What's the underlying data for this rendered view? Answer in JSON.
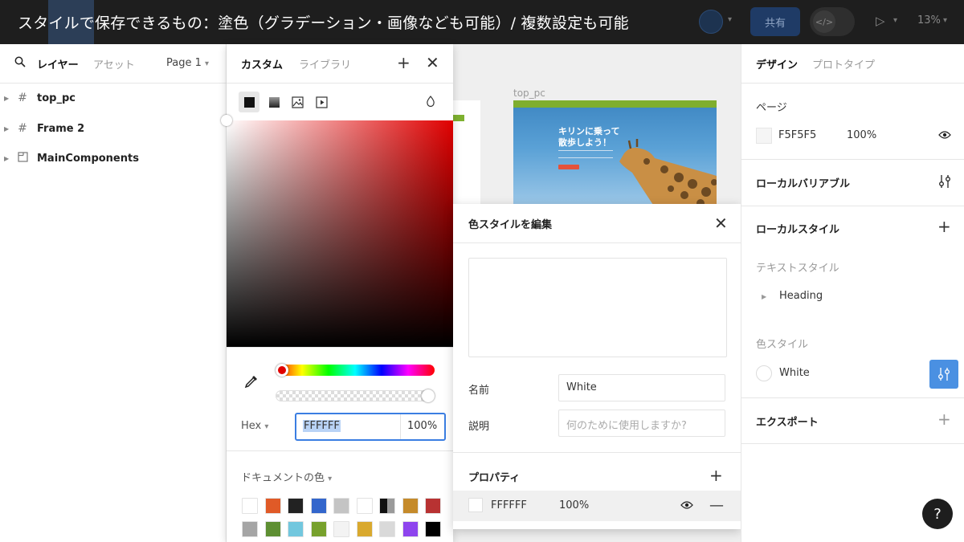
{
  "caption": "スタイルで保存できるもの：塗色（グラデーション・画像なども可能）/ 複数設定も可能",
  "toolbar": {
    "share_label": "共有",
    "zoom": "13%",
    "dev_mode_glyph": "</>"
  },
  "left_panel": {
    "tabs": [
      "レイヤー",
      "アセット"
    ],
    "page_label": "Page 1",
    "layers": [
      {
        "name": "top_pc",
        "icon": "frame-icon"
      },
      {
        "name": "Frame 2",
        "icon": "frame-icon"
      },
      {
        "name": "MainComponents",
        "icon": "section-icon"
      }
    ]
  },
  "canvas": {
    "frame_label": "top_pc",
    "hero_title": "キリンに乗って\n散歩しよう！"
  },
  "color_picker": {
    "tabs": [
      "カスタム",
      "ライブラリ"
    ],
    "paint_types": [
      "solid",
      "gradient",
      "image",
      "video"
    ],
    "current_color": "#FFFFFF",
    "hue_color": "#E00000",
    "format": "Hex",
    "hex": "FFFFFF",
    "opacity": "100%",
    "doc_colors_label": "ドキュメントの色",
    "doc_colors": [
      "#FFFFFF",
      "#E05A27",
      "#222222",
      "#3366CC",
      "#C4C4C4",
      "#FFFFFF",
      "#111111",
      "#C58A2A",
      "#B83232",
      "#A5A5A5",
      "#5E8F32",
      "#72C7DE",
      "#77A12C",
      "#F3F3F3",
      "#D9A92E",
      "#D9D9D9",
      "#8E44EE",
      "#000000"
    ]
  },
  "edit_style": {
    "title": "色スタイルを編集",
    "name_label": "名前",
    "name_value": "White",
    "desc_label": "説明",
    "desc_placeholder": "何のために使用しますか?",
    "properties_label": "プロパティ",
    "property": {
      "hex": "FFFFFF",
      "opacity": "100%"
    }
  },
  "right_panel": {
    "tabs": [
      "デザイン",
      "プロトタイプ"
    ],
    "page_section": "ページ",
    "page_color": {
      "hex": "F5F5F5",
      "opacity": "100%",
      "swatch": "#F5F5F5"
    },
    "local_variables": "ローカルバリアブル",
    "local_styles": "ローカルスタイル",
    "text_styles_label": "テキストスタイル",
    "text_style_item": "Heading",
    "color_styles_label": "色スタイル",
    "color_style_item": "White",
    "export_label": "エクスポート",
    "help": "?"
  }
}
